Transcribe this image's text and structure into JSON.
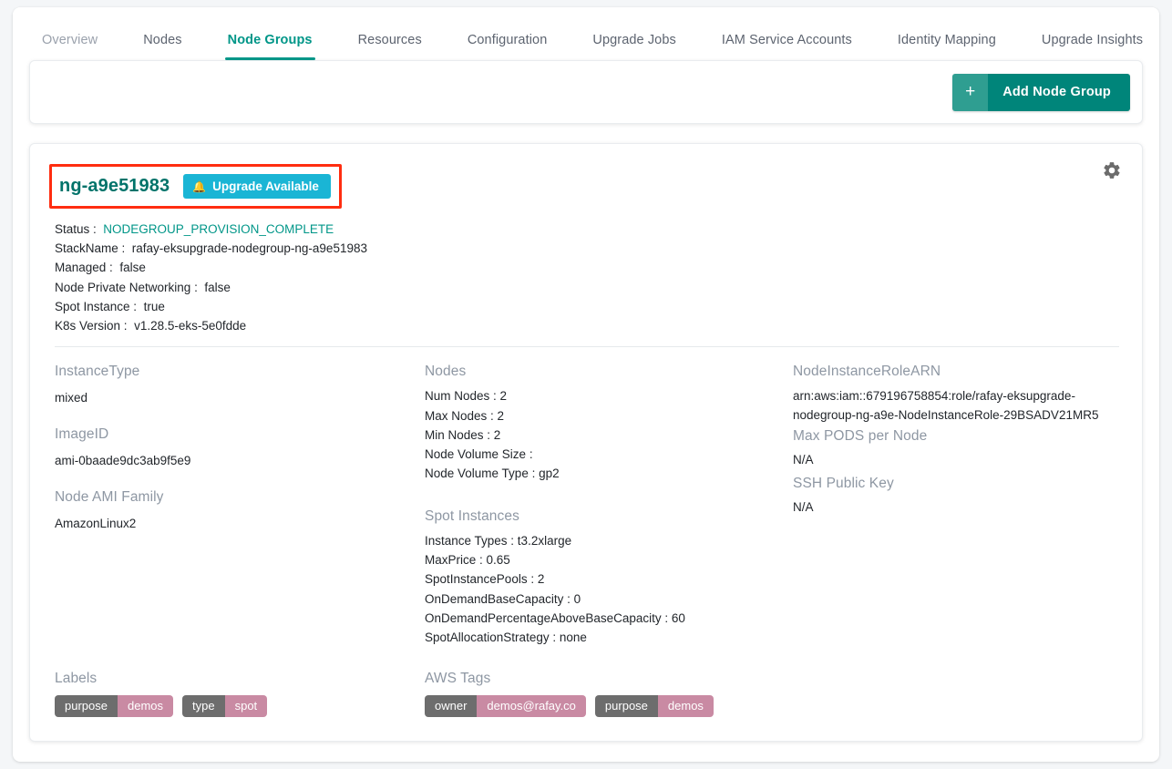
{
  "tabs": [
    {
      "label": "Overview",
      "active": false,
      "muted": true
    },
    {
      "label": "Nodes",
      "active": false,
      "muted": false
    },
    {
      "label": "Node Groups",
      "active": true,
      "muted": false
    },
    {
      "label": "Resources",
      "active": false,
      "muted": false
    },
    {
      "label": "Configuration",
      "active": false,
      "muted": false
    },
    {
      "label": "Upgrade Jobs",
      "active": false,
      "muted": false
    },
    {
      "label": "IAM Service Accounts",
      "active": false,
      "muted": false
    },
    {
      "label": "Identity Mapping",
      "active": false,
      "muted": false
    },
    {
      "label": "Upgrade Insights",
      "active": false,
      "muted": false
    }
  ],
  "toolbar": {
    "add_node_group_plus": "+",
    "add_node_group_label": "Add Node Group"
  },
  "node_group": {
    "name": "ng-a9e51983",
    "badge": {
      "icon": "bell-icon",
      "label": "Upgrade Available"
    },
    "settings_icon": "gear-icon",
    "meta": [
      {
        "key": "Status :",
        "value": "NODEGROUP_PROVISION_COMPLETE",
        "accent": true
      },
      {
        "key": "StackName :",
        "value": "rafay-eksupgrade-nodegroup-ng-a9e51983",
        "accent": false
      },
      {
        "key": "Managed :",
        "value": "false",
        "accent": false
      },
      {
        "key": "Node Private Networking :",
        "value": "false",
        "accent": false
      },
      {
        "key": "Spot Instance :",
        "value": "true",
        "accent": false
      },
      {
        "key": "K8s Version :",
        "value": "v1.28.5-eks-5e0fdde",
        "accent": false
      }
    ],
    "columns": {
      "left": {
        "instance_type_heading": "InstanceType",
        "instance_type_value": "mixed",
        "image_id_heading": "ImageID",
        "image_id_value": "ami-0baade9dc3ab9f5e9",
        "node_ami_family_heading": "Node AMI Family",
        "node_ami_family_value": "AmazonLinux2"
      },
      "middle": {
        "nodes_heading": "Nodes",
        "nodes_rows": [
          "Num Nodes : 2",
          "Max Nodes : 2",
          "Min Nodes : 2",
          "Node Volume Size :",
          "Node Volume Type :  gp2"
        ],
        "spot_heading": "Spot Instances",
        "spot_rows": [
          "Instance Types :  t3.2xlarge",
          "MaxPrice :  0.65",
          "SpotInstancePools :  2",
          "OnDemandBaseCapacity :  0",
          "OnDemandPercentageAboveBaseCapacity :  60",
          "SpotAllocationStrategy :  none"
        ]
      },
      "right": {
        "role_arn_heading": "NodeInstanceRoleARN",
        "role_arn_value": "arn:aws:iam::679196758854:role/rafay-eksupgrade-nodegroup-ng-a9e-NodeInstanceRole-29BSADV21MR5",
        "max_pods_heading": "Max PODS per Node",
        "max_pods_value": "N/A",
        "ssh_key_heading": "SSH Public Key",
        "ssh_key_value": "N/A"
      }
    },
    "labels": {
      "heading": "Labels",
      "chips": [
        {
          "key": "purpose",
          "value": "demos"
        },
        {
          "key": "type",
          "value": "spot"
        }
      ]
    },
    "aws_tags": {
      "heading": "AWS Tags",
      "chips": [
        {
          "key": "owner",
          "value": "demos@rafay.co"
        },
        {
          "key": "purpose",
          "value": "demos"
        }
      ]
    }
  },
  "colors": {
    "teal_accent": "#009688",
    "teal_button": "#00857a",
    "badge_cyan": "#1ab5d5",
    "annotation_red": "#ff2d10",
    "chip_key_gray": "#6d6d6d",
    "chip_value_pink": "#c98aa3",
    "heading_gray": "#8e97a3"
  }
}
